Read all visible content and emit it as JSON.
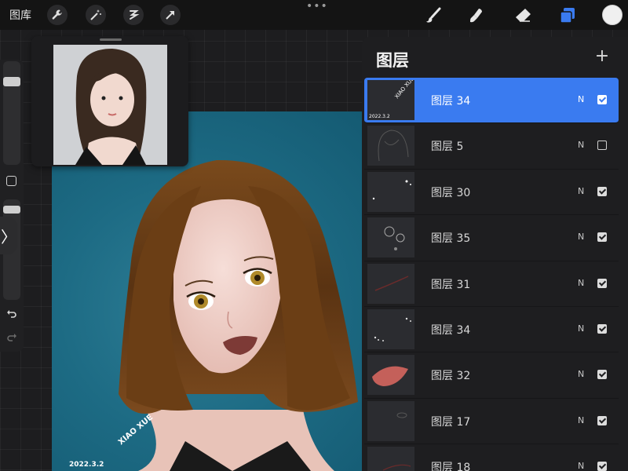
{
  "topbar": {
    "gallery_label": "图库",
    "tools_left": [
      "wrench-icon",
      "magic-wand-icon",
      "selection-icon",
      "transform-arrow-icon"
    ],
    "more_label": "•••",
    "tools_right": [
      "brush-icon",
      "smudge-icon",
      "eraser-icon",
      "layers-icon"
    ],
    "active_tool": "layers-icon",
    "current_color": "#f0f0f0"
  },
  "sidebar": {
    "brush_size_level": 0.85,
    "opacity_level": 0.95,
    "toggle_label": "〉"
  },
  "canvas": {
    "signature": "XIAO XUE",
    "date": "2022.3.2",
    "background_color": "#1d6b84"
  },
  "layers_panel": {
    "title": "图层",
    "add_label": "+",
    "layers": [
      {
        "name": "图层 34",
        "blend": "N",
        "visible": true,
        "selected": true
      },
      {
        "name": "图层 5",
        "blend": "N",
        "visible": false,
        "selected": false
      },
      {
        "name": "图层 30",
        "blend": "N",
        "visible": true,
        "selected": false
      },
      {
        "name": "图层 35",
        "blend": "N",
        "visible": true,
        "selected": false
      },
      {
        "name": "图层 31",
        "blend": "N",
        "visible": true,
        "selected": false
      },
      {
        "name": "图层 34",
        "blend": "N",
        "visible": true,
        "selected": false
      },
      {
        "name": "图层 32",
        "blend": "N",
        "visible": true,
        "selected": false
      },
      {
        "name": "图层 17",
        "blend": "N",
        "visible": true,
        "selected": false
      },
      {
        "name": "图层 18",
        "blend": "N",
        "visible": true,
        "selected": false
      }
    ],
    "accent_color": "#3a7bf0"
  }
}
